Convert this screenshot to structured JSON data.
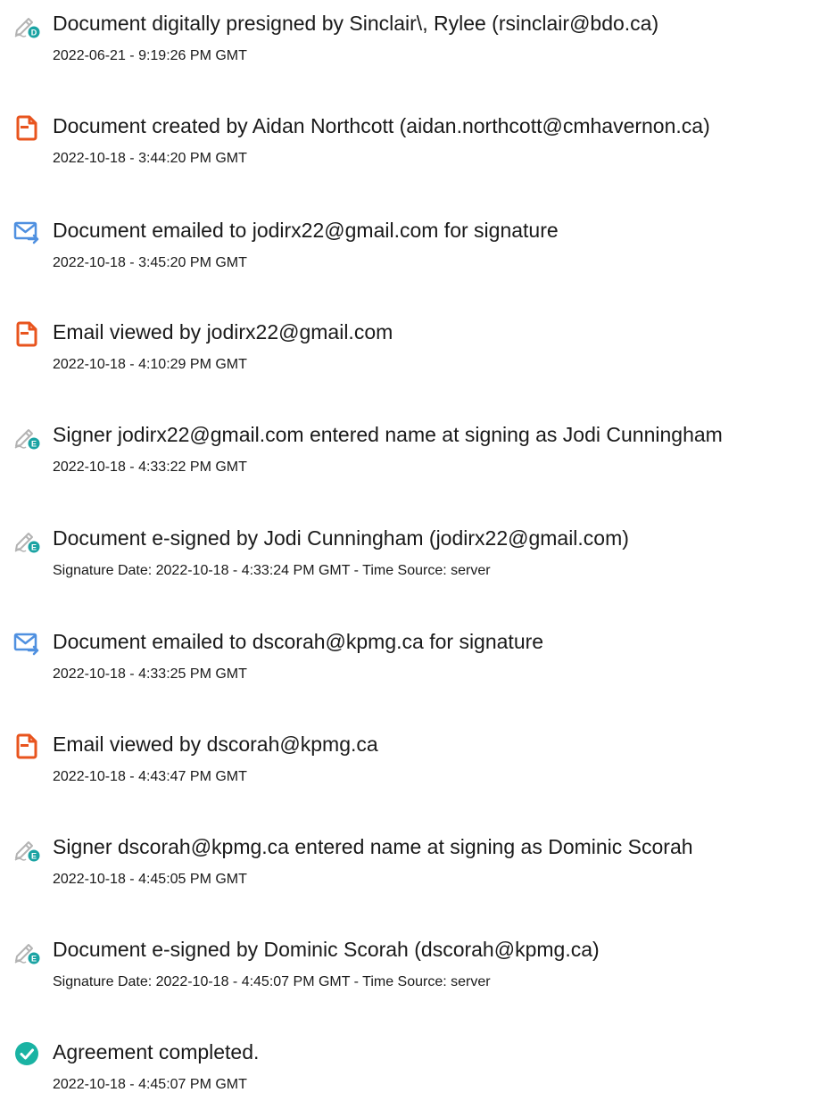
{
  "colors": {
    "pen_gray": "#b3b3b3",
    "badge_teal": "#1aa3a3",
    "doc_orange": "#e8541e",
    "mail_blue": "#4f90e0",
    "check_teal": "#1ab3a3"
  },
  "events": [
    {
      "icon": "pen-icon",
      "badge": "D",
      "title": "Document digitally presigned by Sinclair\\, Rylee (rsinclair@bdo.ca)",
      "subtitle": "2022-06-21 - 9:19:26 PM GMT"
    },
    {
      "icon": "document-icon",
      "title": "Document created by Aidan Northcott (aidan.northcott@cmhavernon.ca)",
      "subtitle": "2022-10-18 - 3:44:20 PM GMT"
    },
    {
      "icon": "email-icon",
      "title": "Document emailed to jodirx22@gmail.com for signature",
      "subtitle": "2022-10-18 - 3:45:20 PM GMT"
    },
    {
      "icon": "document-icon",
      "title": "Email viewed by jodirx22@gmail.com",
      "subtitle": "2022-10-18 - 4:10:29 PM GMT"
    },
    {
      "icon": "pen-icon",
      "badge": "E",
      "title": "Signer jodirx22@gmail.com entered name at signing as Jodi Cunningham",
      "subtitle": "2022-10-18 - 4:33:22 PM GMT"
    },
    {
      "icon": "pen-icon",
      "badge": "E",
      "title": "Document e-signed by Jodi Cunningham (jodirx22@gmail.com)",
      "subtitle": "Signature Date: 2022-10-18 - 4:33:24 PM GMT - Time Source: server"
    },
    {
      "icon": "email-icon",
      "title": "Document emailed to dscorah@kpmg.ca for signature",
      "subtitle": "2022-10-18 - 4:33:25 PM GMT"
    },
    {
      "icon": "document-icon",
      "title": "Email viewed by dscorah@kpmg.ca",
      "subtitle": "2022-10-18 - 4:43:47 PM GMT"
    },
    {
      "icon": "pen-icon",
      "badge": "E",
      "title": "Signer dscorah@kpmg.ca entered name at signing as Dominic Scorah",
      "subtitle": "2022-10-18 - 4:45:05 PM GMT"
    },
    {
      "icon": "pen-icon",
      "badge": "E",
      "title": "Document e-signed by Dominic Scorah (dscorah@kpmg.ca)",
      "subtitle": "Signature Date: 2022-10-18 - 4:45:07 PM GMT - Time Source: server"
    },
    {
      "icon": "checkmark-icon",
      "title": "Agreement completed.",
      "subtitle": "2022-10-18 - 4:45:07 PM GMT"
    }
  ]
}
